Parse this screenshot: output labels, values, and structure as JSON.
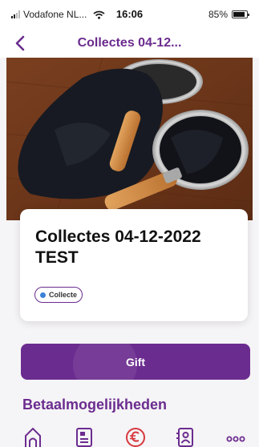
{
  "status_bar": {
    "carrier": "Vodafone NL...",
    "time": "16:06",
    "battery_percent": "85%",
    "battery_level": 0.85
  },
  "nav": {
    "title": "Collectes 04-12..."
  },
  "card": {
    "title": "Collectes 04-12-2022 TEST",
    "badge": "Collecte",
    "badge_dot_color": "#3b82d6"
  },
  "actions": {
    "gift_label": "Gift"
  },
  "section": {
    "title": "Betaalmogelijkheden"
  },
  "theme": {
    "accent": "#6b2c8f",
    "euro_icon_color": "#d9363e"
  },
  "tab_bar": {
    "tabs": [
      {
        "icon": "church-icon"
      },
      {
        "icon": "news-icon"
      },
      {
        "icon": "euro-icon"
      },
      {
        "icon": "contacts-icon"
      },
      {
        "icon": "more-icon"
      }
    ]
  }
}
